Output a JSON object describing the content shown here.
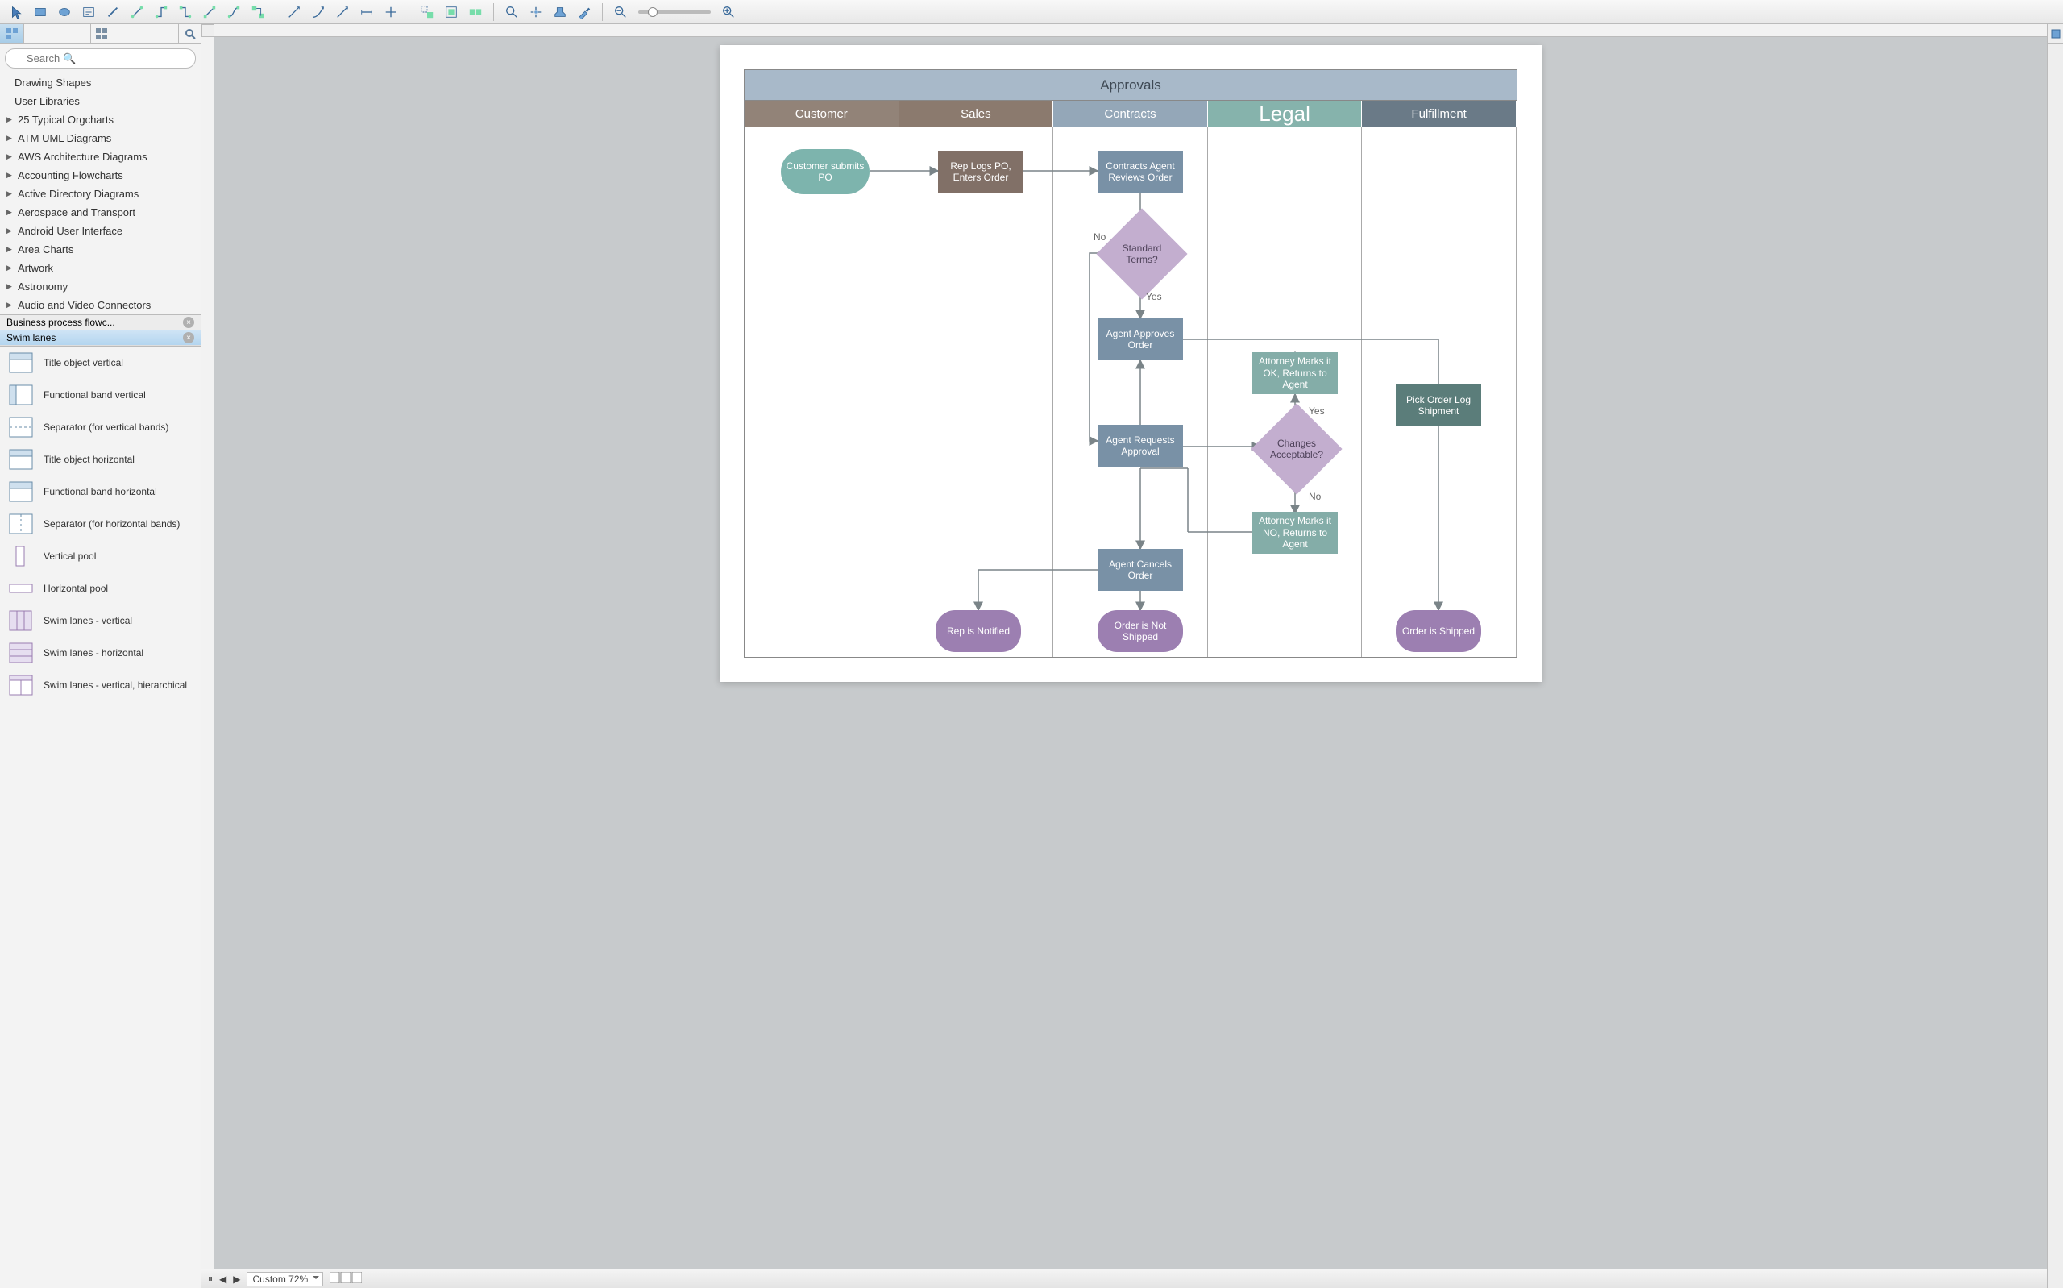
{
  "search": {
    "placeholder": "Search"
  },
  "libs_plain": [
    "Drawing Shapes",
    "User Libraries"
  ],
  "libs_exp": [
    "25 Typical Orgcharts",
    "ATM UML Diagrams",
    "AWS Architecture Diagrams",
    "Accounting Flowcharts",
    "Active Directory Diagrams",
    "Aerospace and Transport",
    "Android User Interface",
    "Area Charts",
    "Artwork",
    "Astronomy",
    "Audio and Video Connectors"
  ],
  "tabsets": [
    {
      "label": "Business process flowc...",
      "selected": false
    },
    {
      "label": "Swim lanes",
      "selected": true
    }
  ],
  "shapes": [
    "Title object vertical",
    "Functional band vertical",
    "Separator (for vertical bands)",
    "Title object horizontal",
    "Functional band horizontal",
    "Separator (for horizontal bands)",
    "Vertical pool",
    "Horizontal pool",
    "Swim lanes - vertical",
    "Swim lanes - horizontal",
    "Swim lanes - vertical, hierarchical"
  ],
  "zoom_label": "Custom 72%",
  "diagram": {
    "title": "Approvals",
    "lanes": [
      {
        "label": "Customer",
        "color": "#928378"
      },
      {
        "label": "Sales",
        "color": "#8b7a6e"
      },
      {
        "label": "Contracts",
        "color": "#94a7b8"
      },
      {
        "label": "Legal",
        "color": "#86b3ac",
        "big": true
      },
      {
        "label": "Fulfillment",
        "color": "#6a7a87"
      }
    ],
    "nodes": {
      "customer_po": "Customer submits PO",
      "rep_logs": "Rep Logs PO, Enters Order",
      "contracts_rev": "Contracts Agent Reviews Order",
      "std_terms": "Standard Terms?",
      "approves": "Agent Approves Order",
      "requests": "Agent Requests Approval",
      "changes": "Changes Acceptable?",
      "att_ok": "Attorney Marks it OK, Returns to Agent",
      "att_no": "Attorney Marks it NO, Returns to Agent",
      "cancels": "Agent Cancels Order",
      "pick": "Pick Order Log Shipment",
      "rep_notified": "Rep is Notified",
      "not_shipped": "Order is Not Shipped",
      "shipped": "Order is Shipped"
    },
    "labels": {
      "yes": "Yes",
      "no": "No"
    }
  }
}
